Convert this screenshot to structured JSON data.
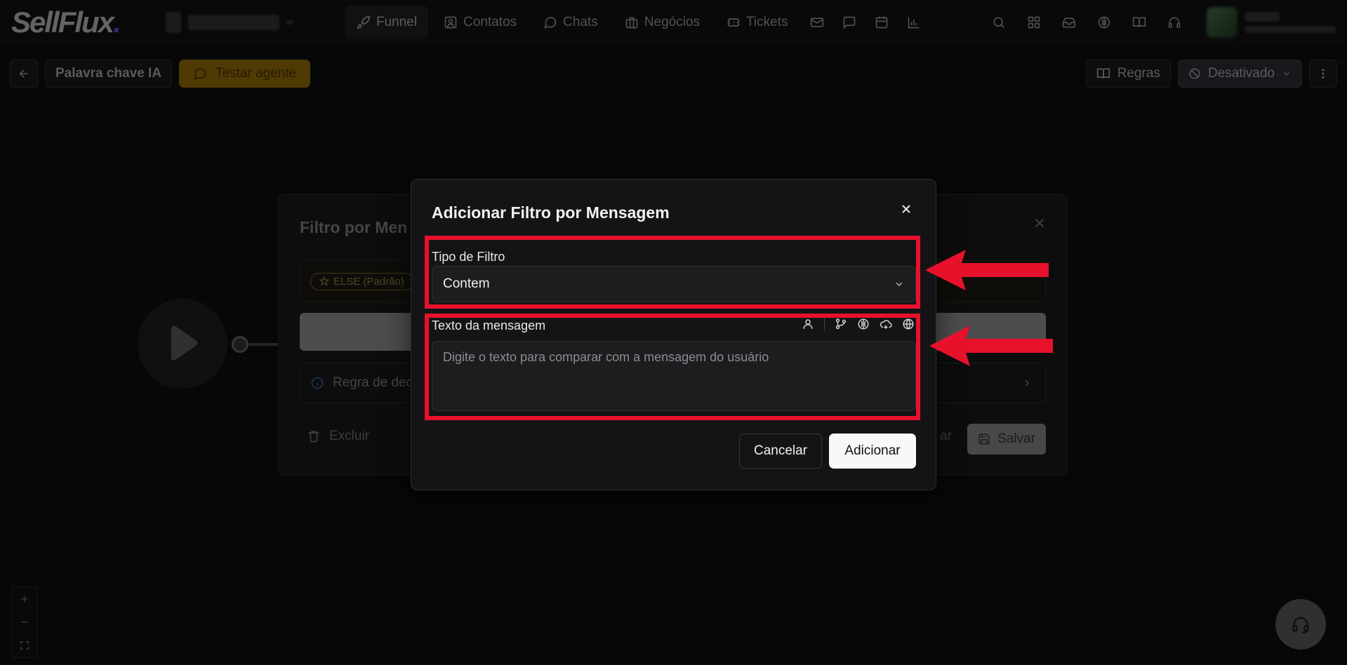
{
  "app": {
    "logo_text": "SellFlux"
  },
  "nav": {
    "items": [
      {
        "label": "Funnel",
        "icon": "rocket-icon",
        "active": true
      },
      {
        "label": "Contatos",
        "icon": "contact-card-icon"
      },
      {
        "label": "Chats",
        "icon": "chat-bubble-icon"
      },
      {
        "label": "Negócios",
        "icon": "briefcase-icon"
      },
      {
        "label": "Tickets",
        "icon": "ticket-icon"
      }
    ],
    "extra_icons": [
      "mail-icon",
      "message-square-icon",
      "calendar-icon",
      "bar-chart-icon"
    ],
    "right_icons": [
      "search-icon",
      "apps-grid-icon",
      "inbox-icon",
      "brain-icon",
      "book-icon",
      "headset-icon"
    ]
  },
  "toolbar": {
    "flow_name": "Palavra chave IA",
    "test_agent_label": "Testar agente",
    "rules_label": "Regras",
    "status_label": "Desativado"
  },
  "bg_card": {
    "title": "Filtro por Men",
    "else_badge": "ELSE (Padrão)",
    "info_text": "Regra de dec",
    "delete_label": "Excluir",
    "partial_label": "ar",
    "save_label": "Salvar"
  },
  "modal": {
    "title": "Adicionar Filtro por Mensagem",
    "filter_type_label": "Tipo de Filtro",
    "filter_type_value": "Contem",
    "message_text_label": "Texto da mensagem",
    "message_text_placeholder": "Digite o texto para comparar com a mensagem do usuário",
    "cancel_label": "Cancelar",
    "add_label": "Adicionar"
  },
  "colors": {
    "accent_amber": "#7a5a05",
    "highlight_red": "#e8112b"
  }
}
